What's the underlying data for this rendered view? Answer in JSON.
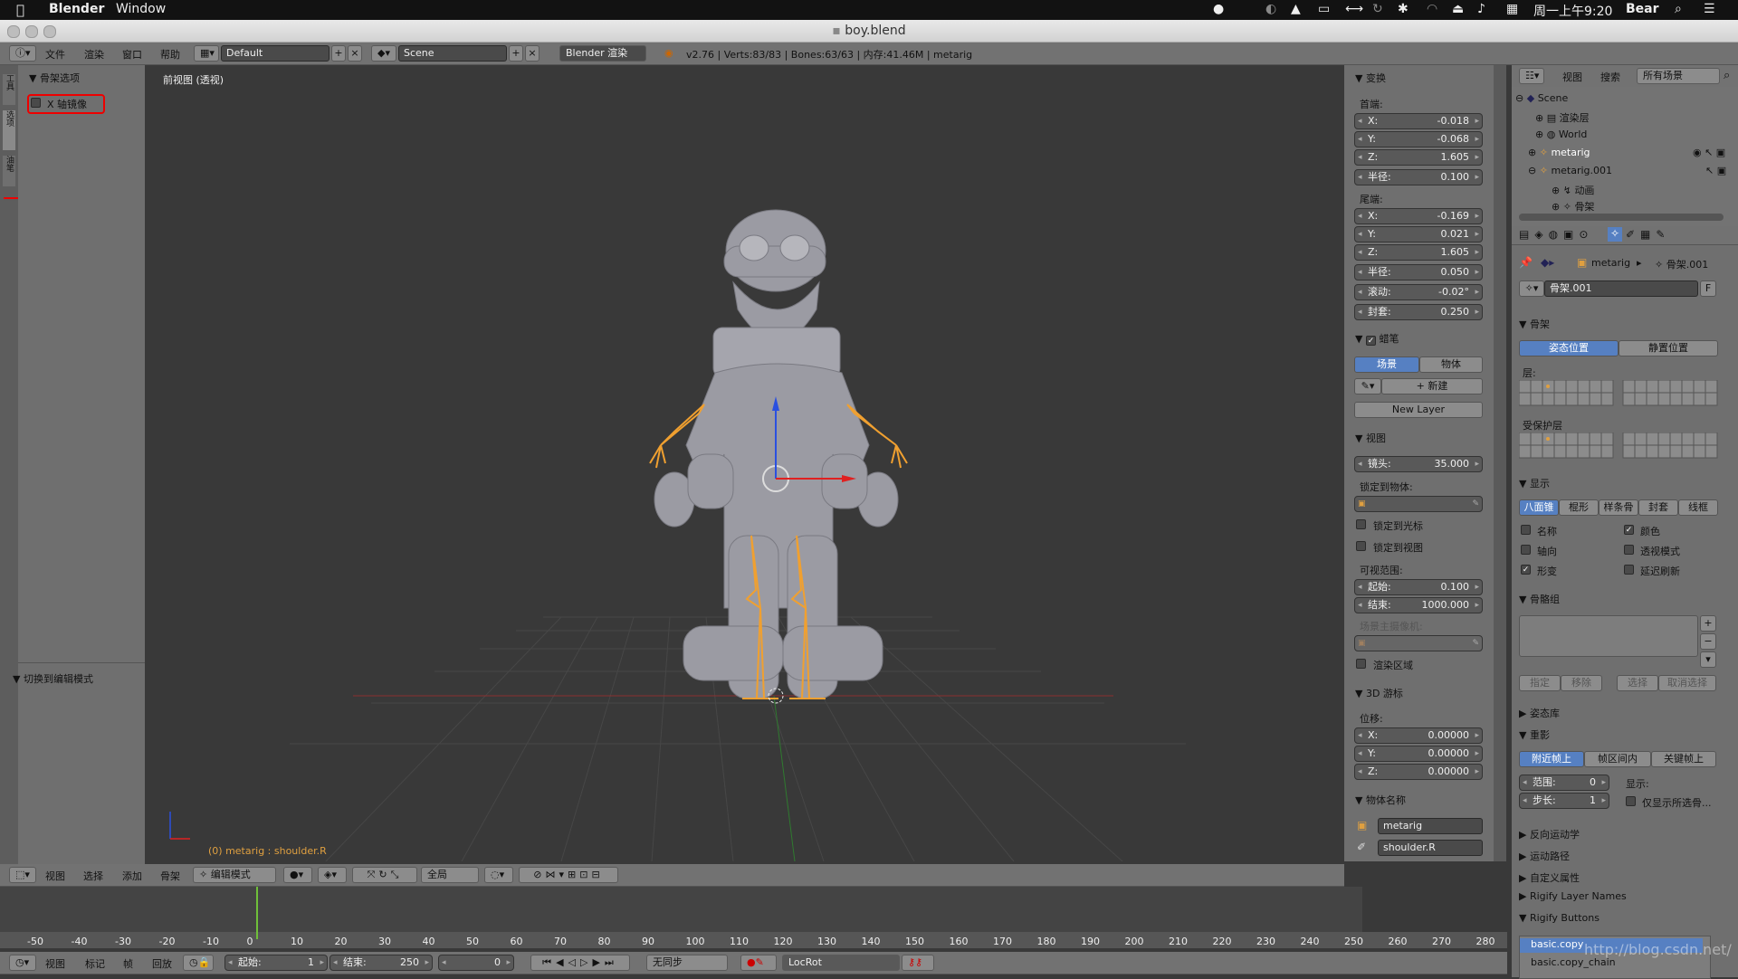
{
  "mac": {
    "app": "Blender",
    "menu_window": "Window",
    "datetime": "周一上午9:20",
    "user": "Bear"
  },
  "window": {
    "title": "boy.blend"
  },
  "top": {
    "menus": [
      "文件",
      "渲染",
      "窗口",
      "帮助"
    ],
    "layout": "Default",
    "scene": "Scene",
    "engine": "Blender 渲染",
    "stats": "v2.76 | Verts:83/83 | Bones:63/63 | 内存:41.46M | metarig"
  },
  "left_tools": {
    "tabs": [
      "工具",
      "选项",
      "油笔"
    ],
    "panel_title": "骨架选项",
    "x_mirror": "X 轴镜像",
    "op_panel": "切换到编辑模式"
  },
  "viewport": {
    "label": "前视图 (透视)",
    "status": "(0) metarig : shoulder.R"
  },
  "nprops": {
    "transform_title": "变换",
    "head_label": "首端:",
    "head": [
      {
        "k": "X:",
        "v": "-0.018"
      },
      {
        "k": "Y:",
        "v": "-0.068"
      },
      {
        "k": "Z:",
        "v": "1.605"
      },
      {
        "k": "半径:",
        "v": "0.100"
      }
    ],
    "tail_label": "尾端:",
    "tail": [
      {
        "k": "X:",
        "v": "-0.169"
      },
      {
        "k": "Y:",
        "v": "0.021"
      },
      {
        "k": "Z:",
        "v": "1.605"
      },
      {
        "k": "半径:",
        "v": "0.050"
      },
      {
        "k": "滚动:",
        "v": "-0.02°"
      },
      {
        "k": "封套:",
        "v": "0.250"
      }
    ],
    "gp_title": "蜡笔",
    "gp_scene": "场景",
    "gp_object": "物体",
    "gp_new": "新建",
    "gp_new_layer": "New Layer",
    "view_title": "视图",
    "lens_k": "镜头:",
    "lens_v": "35.000",
    "lock_obj": "锁定到物体:",
    "lock_cursor": "锁定到光标",
    "lock_view": "锁定到视图",
    "clip": "可视范围:",
    "clip_start_k": "起始:",
    "clip_start_v": "0.100",
    "clip_end_k": "结束:",
    "clip_end_v": "1000.000",
    "local_cam": "场景主摄像机:",
    "render_border": "渲染区域",
    "cursor_title": "3D 游标",
    "loc": "位移:",
    "cursor": [
      {
        "k": "X:",
        "v": "0.00000"
      },
      {
        "k": "Y:",
        "v": "0.00000"
      },
      {
        "k": "Z:",
        "v": "0.00000"
      }
    ],
    "item_title": "物体名称",
    "item_obj": "metarig",
    "item_bone": "shoulder.R"
  },
  "outliner": {
    "menus": [
      "视图",
      "搜索"
    ],
    "filter": "所有场景",
    "items": [
      "Scene",
      "渲染层",
      "World",
      "metarig",
      "metarig.001",
      "动画",
      "骨架"
    ]
  },
  "props": {
    "crumb_obj": "metarig",
    "crumb_data": "骨架.001",
    "data_name": "骨架.001",
    "data_f": "F",
    "skeleton_title": "骨架",
    "pose_pos": "姿态位置",
    "rest_pos": "静置位置",
    "layers": "层:",
    "protected": "受保护层",
    "display_title": "显示",
    "disp": [
      "八面锥",
      "棍形",
      "样条骨",
      "封套",
      "线框"
    ],
    "names": "名称",
    "axes": "轴向",
    "shape": "形变",
    "colors": "颜色",
    "xray": "透视模式",
    "delay": "延迟刷新",
    "groups_title": "骨骼组",
    "assign": "指定",
    "remove": "移除",
    "select": "选择",
    "deselect": "取消选择",
    "pose_lib": "姿态库",
    "ghost_title": "重影",
    "ghost_types": [
      "附近帧上",
      "帧区间内",
      "关键帧上"
    ],
    "range_k": "范围:",
    "range_v": "0",
    "step_k": "步长:",
    "step_v": "1",
    "show": "显示:",
    "only_sel": "仅显示所选骨...",
    "ik": "反向运动学",
    "motion": "运动路径",
    "custom": "自定义属性",
    "rigify_names": "Rigify Layer Names",
    "rigify_buttons": "Rigify Buttons",
    "list": [
      "basic.copy",
      "basic.copy_chain"
    ]
  },
  "vheader": {
    "menus": [
      "视图",
      "选择",
      "添加",
      "骨架"
    ],
    "mode": "编辑模式",
    "pivot": "全局"
  },
  "timeline": {
    "ticks": [
      "-50",
      "-40",
      "-30",
      "-20",
      "-10",
      "0",
      "10",
      "20",
      "30",
      "40",
      "50",
      "60",
      "70",
      "80",
      "90",
      "100",
      "110",
      "120",
      "130",
      "140",
      "150",
      "160",
      "170",
      "180",
      "190",
      "200",
      "210",
      "220",
      "230",
      "240",
      "250",
      "260",
      "270",
      "280"
    ],
    "menus": [
      "视图",
      "标记",
      "帧",
      "回放"
    ],
    "start_k": "起始:",
    "start_v": "1",
    "end_k": "结束:",
    "end_v": "250",
    "current": "0",
    "sync": "无同步",
    "keyset": "LocRot"
  },
  "watermark": "http://blog.csdn.net/"
}
